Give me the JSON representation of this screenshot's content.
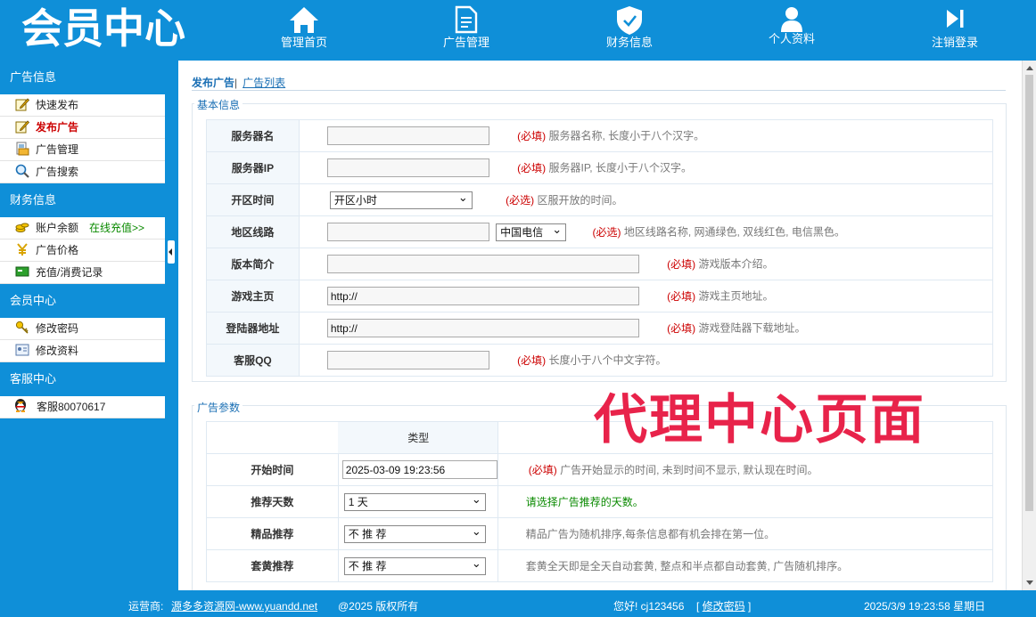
{
  "header": {
    "logo": "会员中心",
    "nav": [
      {
        "label": "管理首页",
        "icon": "home-icon"
      },
      {
        "label": "广告管理",
        "icon": "document-icon"
      },
      {
        "label": "财务信息",
        "icon": "shield-icon"
      },
      {
        "label": "个人资料",
        "icon": "user-icon"
      },
      {
        "label": "注销登录",
        "icon": "skip-forward-icon"
      }
    ]
  },
  "sidebar": {
    "groups": [
      {
        "title": "广告信息",
        "items": [
          {
            "label": "快速发布",
            "icon": "pencil-icon"
          },
          {
            "label": "发布广告",
            "icon": "pencil-icon",
            "active": true
          },
          {
            "label": "广告管理",
            "icon": "folder-icon"
          },
          {
            "label": "广告搜索",
            "icon": "magnifier-icon"
          }
        ]
      },
      {
        "title": "财务信息",
        "items": [
          {
            "label": "账户余额",
            "icon": "coins-icon",
            "extra": "在线充值>>"
          },
          {
            "label": "广告价格",
            "icon": "yen-icon"
          },
          {
            "label": "充值/消费记录",
            "icon": "card-icon"
          }
        ]
      },
      {
        "title": "会员中心",
        "items": [
          {
            "label": "修改密码",
            "icon": "key-icon"
          },
          {
            "label": "修改资料",
            "icon": "profile-card-icon"
          }
        ]
      },
      {
        "title": "客服中心",
        "items": [
          {
            "label": "客服80070617",
            "icon": "qq-penguin-icon"
          }
        ]
      }
    ]
  },
  "breadcrumb": {
    "current": "发布广告",
    "separator": "|",
    "link": "广告列表"
  },
  "basic": {
    "legend": "基本信息",
    "rows": [
      {
        "label": "服务器名",
        "value": "",
        "req": "(必填)",
        "hint": " 服务器名称, 长度小于八个汉字。"
      },
      {
        "label": "服务器IP",
        "value": "",
        "req": "(必填)",
        "hint": " 服务器IP, 长度小于八个汉字。"
      },
      {
        "label": "开区时间",
        "select": "开区小时",
        "req": "(必选)",
        "hint": " 区服开放的时间。"
      },
      {
        "label": "地区线路",
        "value": "",
        "select": "中国电信",
        "req": "(必选)",
        "hint": " 地区线路名称, 网通绿色, 双线红色, 电信黑色。"
      },
      {
        "label": "版本简介",
        "value": "",
        "req": "(必填)",
        "hint": " 游戏版本介绍。"
      },
      {
        "label": "游戏主页",
        "value": "http://",
        "req": "(必填)",
        "hint": " 游戏主页地址。"
      },
      {
        "label": "登陆器地址",
        "value": "http://",
        "req": "(必填)",
        "hint": " 游戏登陆器下载地址。"
      },
      {
        "label": "客服QQ",
        "value": "",
        "req": "(必填)",
        "hint": " 长度小于八个中文字符。"
      }
    ]
  },
  "params": {
    "legend": "广告参数",
    "type_header": "类型",
    "rows": [
      {
        "label": "开始时间",
        "value": "2025-03-09 19:23:56",
        "req": "(必填)",
        "hint": " 广告开始显示的时间, 未到时间不显示, 默认现在时间。"
      },
      {
        "label": "推荐天数",
        "select": "1 天",
        "hint": "请选择广告推荐的天数。"
      },
      {
        "label": "精品推荐",
        "select": "不 推 荐",
        "hint": "精品广告为随机排序,每条信息都有机会排在第一位。"
      },
      {
        "label": "套黄推荐",
        "select": "不 推 荐",
        "hint": "套黄全天即是全天自动套黄, 整点和半点都自动套黄, 广告随机排序。"
      }
    ]
  },
  "overlay_text": "代理中心页面",
  "footer": {
    "operator_label": "运营商:",
    "operator_link": "源多多资源网-www.yuandd.net",
    "copyright": "@2025 版权所有",
    "greeting": "您好!  cj123456",
    "change_pwd": "修改密码",
    "datetime": "2025/3/9 19:23:58 星期日"
  },
  "colors": {
    "brand_blue": "#0f8fd8",
    "required_red": "#cc0000",
    "hint_green": "#0a8a00",
    "stamp_red": "#e8234a"
  }
}
